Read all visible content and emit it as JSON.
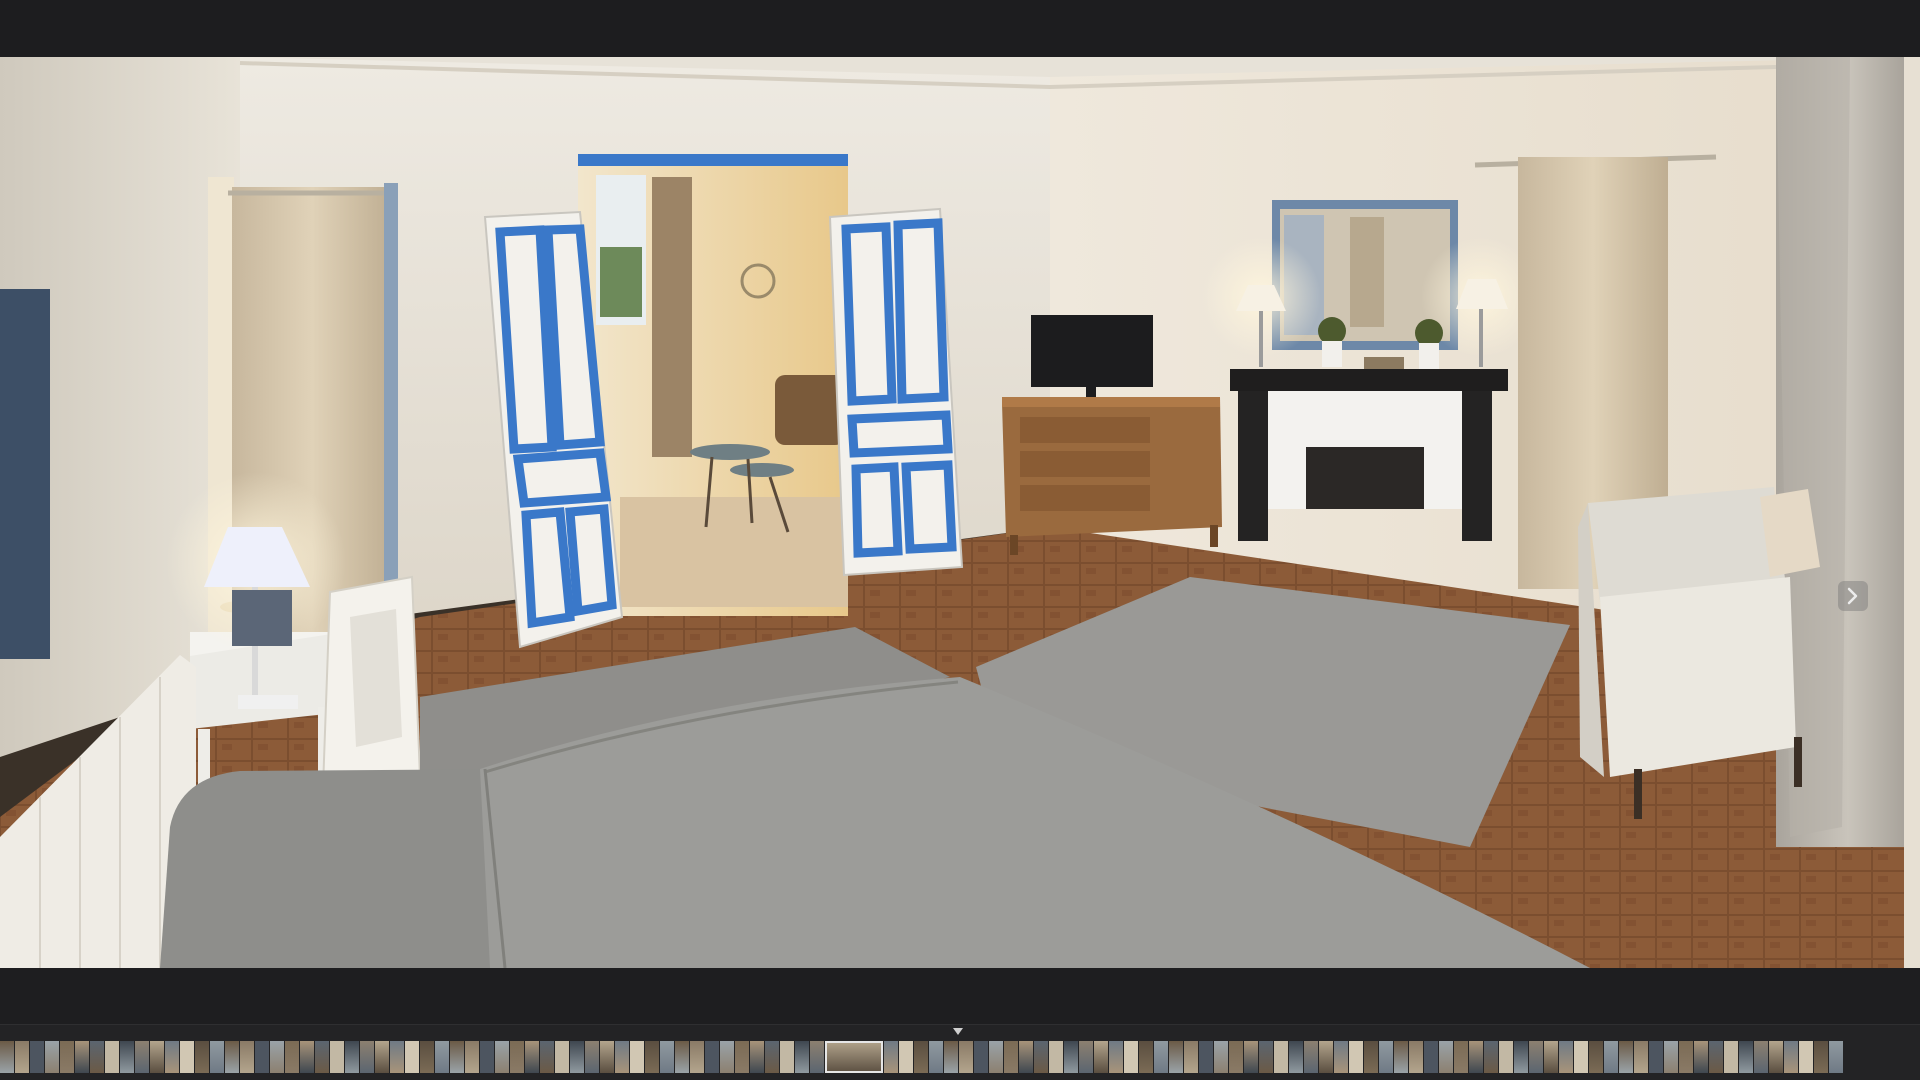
{
  "viewer": {
    "background_color": "#1c1c1d"
  },
  "photo": {
    "subject": "bedroom-interior",
    "accent_blue": "#3a78c9"
  },
  "navigation": {
    "next_icon": "chevron-right-icon"
  },
  "filmstrip": {
    "marker_icon": "triangle-down-icon",
    "thumbnail_count": 120,
    "selected_index": 55,
    "palette": [
      "#6b5a46",
      "#8a7a66",
      "#4d5560",
      "#9aa3a8",
      "#7b6b55",
      "#a8947a",
      "#5b6570",
      "#c2b8a4",
      "#3f4750",
      "#8c8070",
      "#b3a58d",
      "#6f7a85",
      "#d1c7b3",
      "#5a4e40",
      "#909aa0"
    ]
  }
}
